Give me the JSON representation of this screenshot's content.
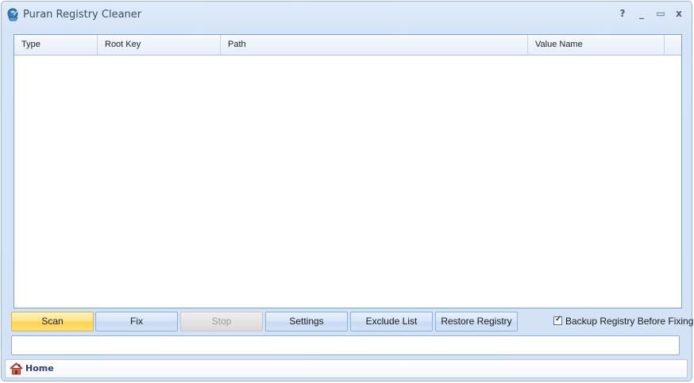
{
  "window": {
    "title": "Puran Registry Cleaner",
    "controls": {
      "help": "?",
      "minimize": "_",
      "maximize": "▭",
      "close": "x"
    }
  },
  "grid": {
    "columns": [
      "Type",
      "Root Key",
      "Path",
      "Value Name"
    ],
    "rows": []
  },
  "actions": {
    "scan": "Scan",
    "fix": "Fix",
    "stop": "Stop",
    "settings": "Settings",
    "exclude_list": "Exclude List",
    "restore_registry": "Restore Registry"
  },
  "backup_option": {
    "label": "Backup Registry Before Fixing",
    "checked": true
  },
  "status": {
    "value": ""
  },
  "footer": {
    "home_label": "Home"
  },
  "icons": {
    "app": "registry-cleaner-app-icon",
    "home": "home-icon"
  },
  "colors": {
    "accent_scan": "#ffd24f",
    "window_bg": "#d5e4f6",
    "home_text": "#2f3b78"
  }
}
